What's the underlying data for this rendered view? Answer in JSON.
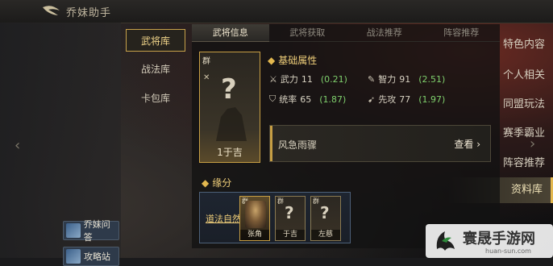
{
  "app": {
    "title": "乔妹助手"
  },
  "left_nav": {
    "items": [
      {
        "label": "特色内容"
      },
      {
        "label": "个人相关"
      },
      {
        "label": "同盟玩法"
      },
      {
        "label": "赛季霸业"
      },
      {
        "label": "阵容推荐"
      },
      {
        "label": "资料库"
      }
    ],
    "active_index": 5,
    "buttons": [
      {
        "label": "乔妹问答",
        "icon": "avatar-icon"
      },
      {
        "label": "攻略站",
        "icon": "avatar-icon"
      }
    ]
  },
  "sub_nav": {
    "items": [
      {
        "label": "武将库"
      },
      {
        "label": "战法库"
      },
      {
        "label": "卡包库"
      }
    ],
    "active_index": 0
  },
  "tabs": [
    {
      "label": "武将信息"
    },
    {
      "label": "武将获取"
    },
    {
      "label": "战法推荐"
    },
    {
      "label": "阵容推荐"
    }
  ],
  "general": {
    "faction": "群",
    "cost_name": "1于吉",
    "question_mark": "?",
    "badge_icon": "crossed-swords-icon"
  },
  "basic_attrs": {
    "title": "基础属性",
    "items": [
      {
        "icon": "sword-icon",
        "label": "武力",
        "value": "11",
        "growth": "(0.21)"
      },
      {
        "icon": "intelligence-icon",
        "label": "智力",
        "value": "91",
        "growth": "(2.51)"
      },
      {
        "icon": "shield-icon",
        "label": "统率",
        "value": "65",
        "growth": "(1.87)"
      },
      {
        "icon": "speed-icon",
        "label": "先攻",
        "value": "77",
        "growth": "(1.97)"
      }
    ]
  },
  "skill": {
    "name": "风急雨骤",
    "view_label": "查看"
  },
  "fate": {
    "title": "缘分",
    "name": "道法自然",
    "members": [
      {
        "faction": "群",
        "name": "张角"
      },
      {
        "faction": "群",
        "name": "于吉"
      },
      {
        "faction": "群",
        "name": "左慈"
      }
    ]
  },
  "watermark": {
    "text": "寰晟手游网",
    "url": "huan-sun.com"
  },
  "colors": {
    "accent": "#e3b84f",
    "growth": "#7fd06d",
    "tab_active": "#efe6cf"
  }
}
